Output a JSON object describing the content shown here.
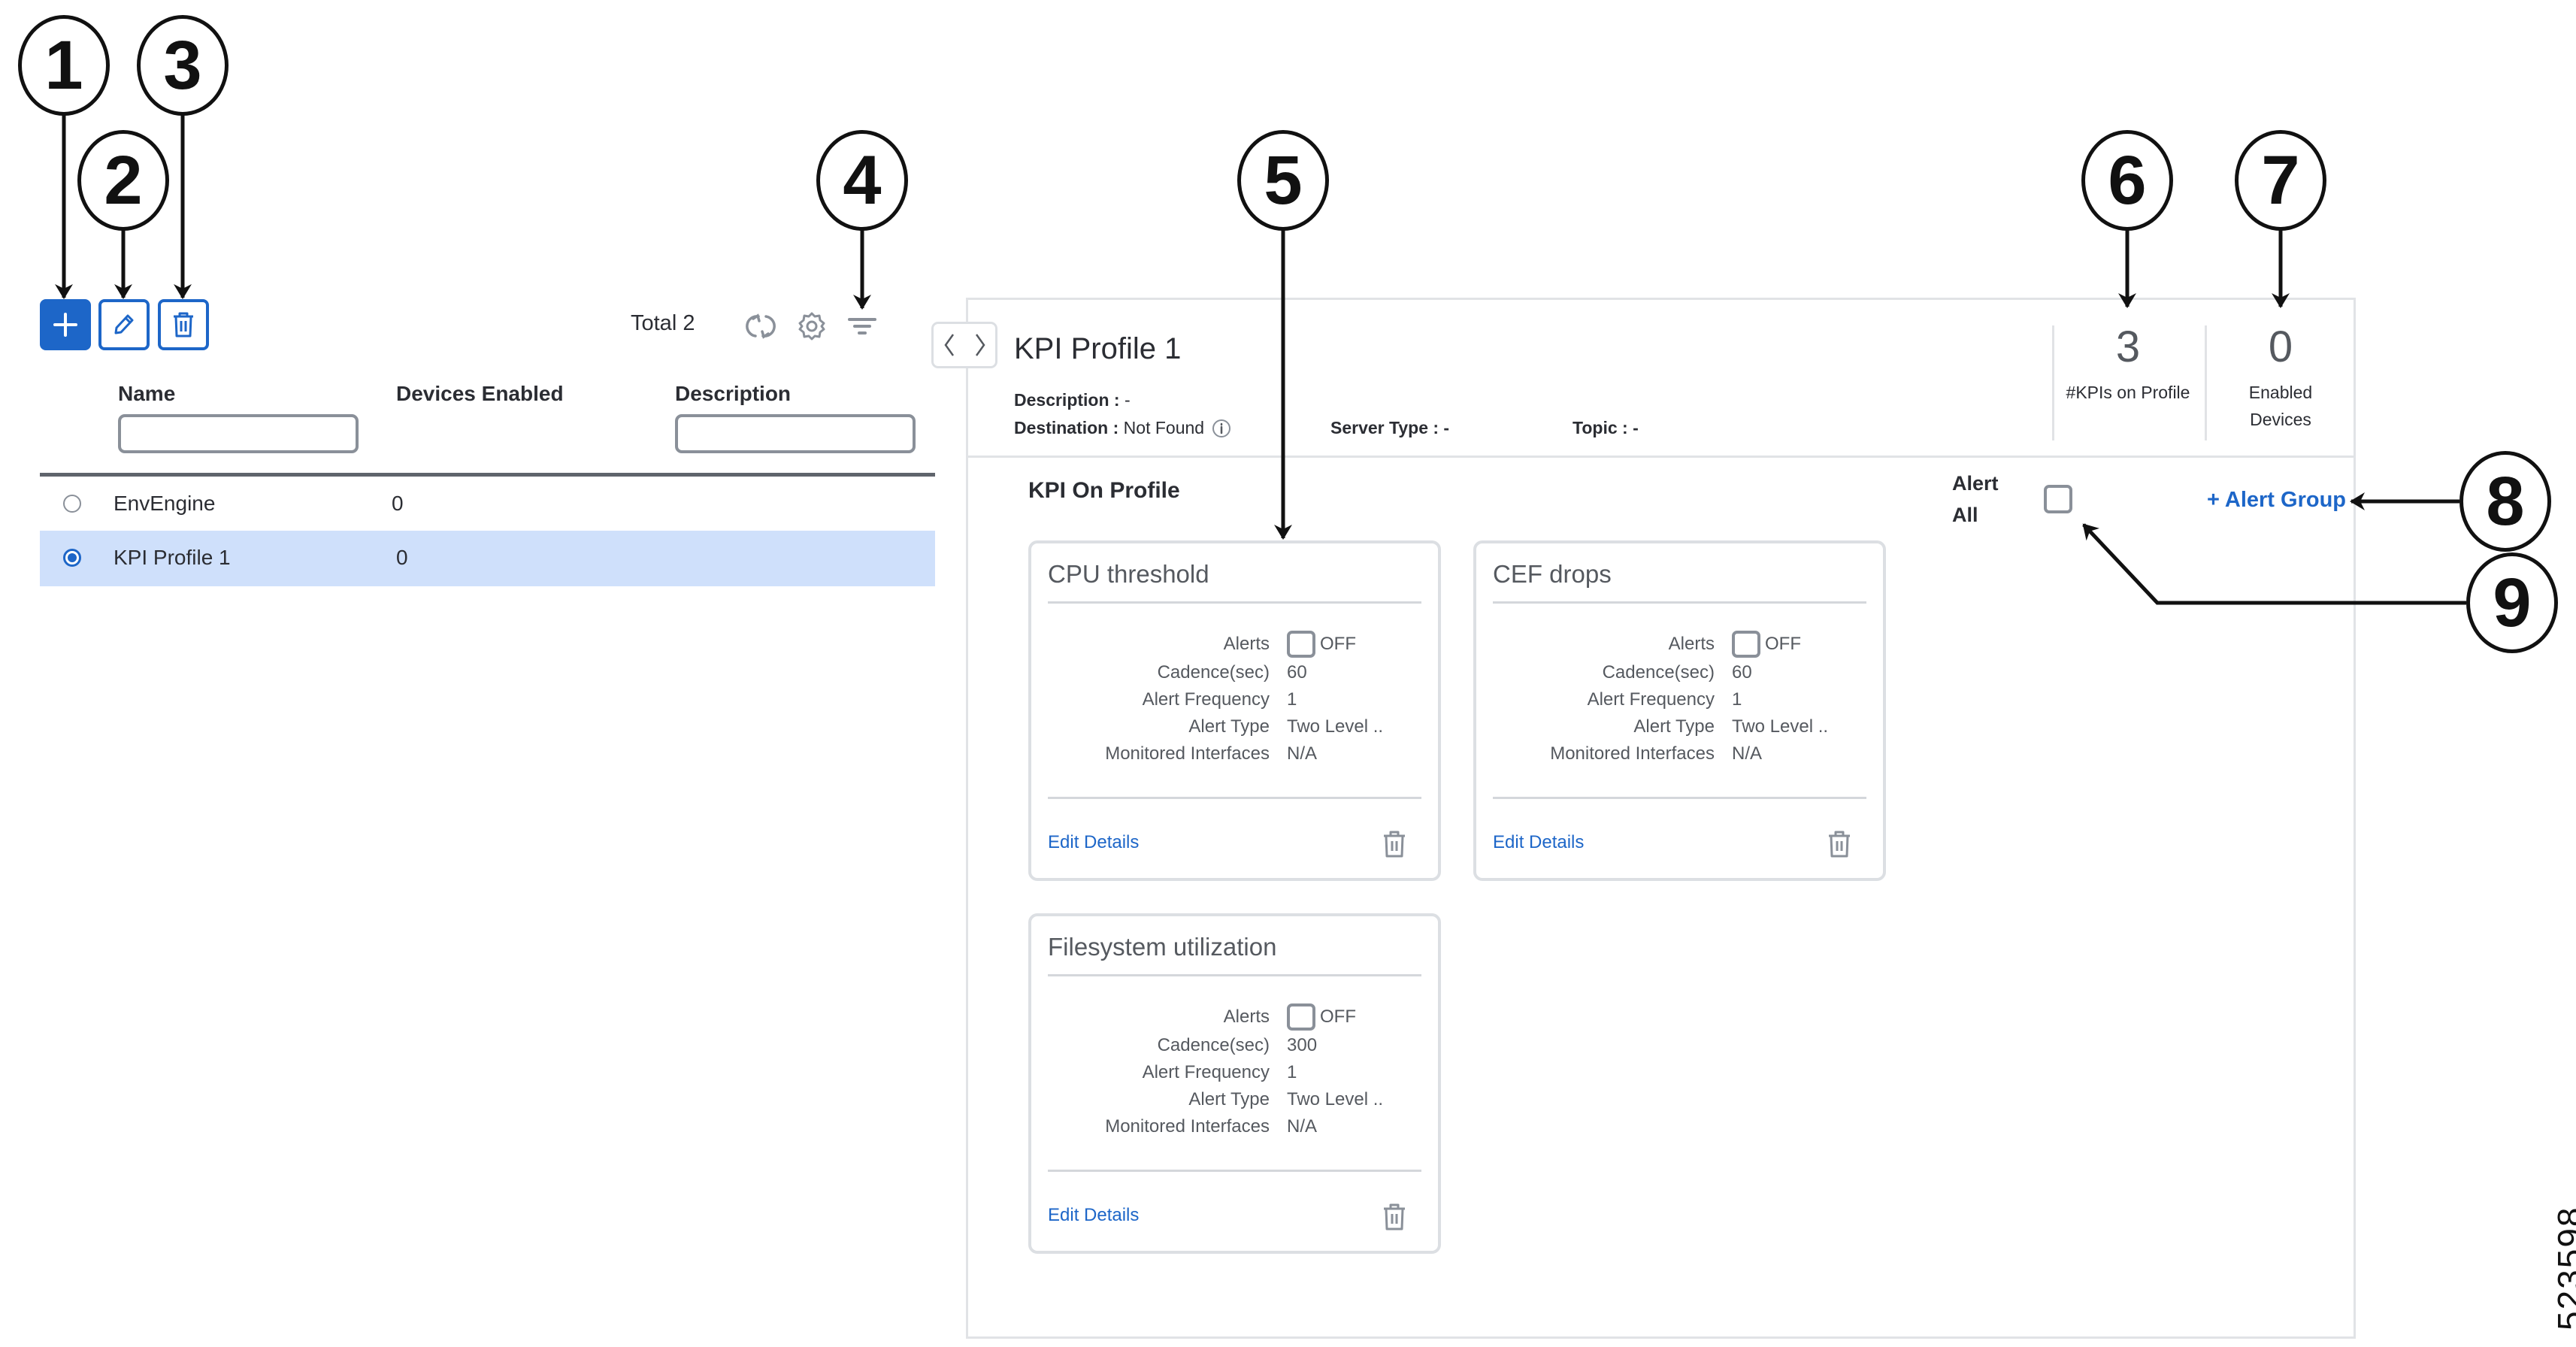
{
  "callouts": [
    "1",
    "2",
    "3",
    "4",
    "5",
    "6",
    "7",
    "8",
    "9"
  ],
  "toolbar": {
    "add_icon": "plus-icon",
    "edit_icon": "pencil-icon",
    "delete_icon": "trash-icon",
    "total_label": "Total 2",
    "refresh_icon": "refresh-icon",
    "settings_icon": "gear-icon",
    "filter_icon": "filter-icon"
  },
  "table": {
    "columns": [
      "Name",
      "Devices Enabled",
      "Description"
    ],
    "name_filter": {
      "value": "",
      "placeholder": ""
    },
    "description_filter": {
      "value": "",
      "placeholder": ""
    },
    "rows": [
      {
        "name": "EnvEngine",
        "devices_enabled": "0",
        "description": "",
        "selected": false
      },
      {
        "name": "KPI Profile 1",
        "devices_enabled": "0",
        "description": "",
        "selected": true
      }
    ]
  },
  "detail": {
    "nav_prev_icon": "chevron-left-icon",
    "nav_next_icon": "chevron-right-icon",
    "title": "KPI Profile 1",
    "description_label": "Description :",
    "description_value": "-",
    "destination_label": "Destination :",
    "destination_value": "Not Found",
    "destination_info_icon": "info-icon",
    "server_type_label": "Server Type :",
    "server_type_value": "-",
    "topic_label": "Topic :",
    "topic_value": "-",
    "stats": [
      {
        "value": "3",
        "label": "#KPIs on Profile"
      },
      {
        "value": "0",
        "label": "Enabled Devices"
      }
    ],
    "section_title": "KPI On Profile",
    "alert_all_label": "Alert All",
    "alert_all_checked": false,
    "alert_group_label": "+ Alert Group",
    "card_labels": {
      "alerts": "Alerts",
      "cadence": "Cadence(sec)",
      "frequency": "Alert Frequency",
      "type": "Alert Type",
      "interfaces": "Monitored Interfaces",
      "edit": "Edit Details"
    },
    "kpis": [
      {
        "name": "CPU threshold",
        "alerts": "OFF",
        "alerts_on": false,
        "cadence": "60",
        "frequency": "1",
        "type": "Two Level ..",
        "interfaces": "N/A"
      },
      {
        "name": "CEF drops",
        "alerts": "OFF",
        "alerts_on": false,
        "cadence": "60",
        "frequency": "1",
        "type": "Two Level ..",
        "interfaces": "N/A"
      },
      {
        "name": "Filesystem utilization",
        "alerts": "OFF",
        "alerts_on": false,
        "cadence": "300",
        "frequency": "1",
        "type": "Two Level ..",
        "interfaces": "N/A"
      }
    ]
  },
  "figure_id": "523598",
  "colors": {
    "accent": "#1d66c8",
    "selected_row": "#cfe0fb",
    "border": "#e1e3e6",
    "icon_gray": "#8a9099"
  }
}
